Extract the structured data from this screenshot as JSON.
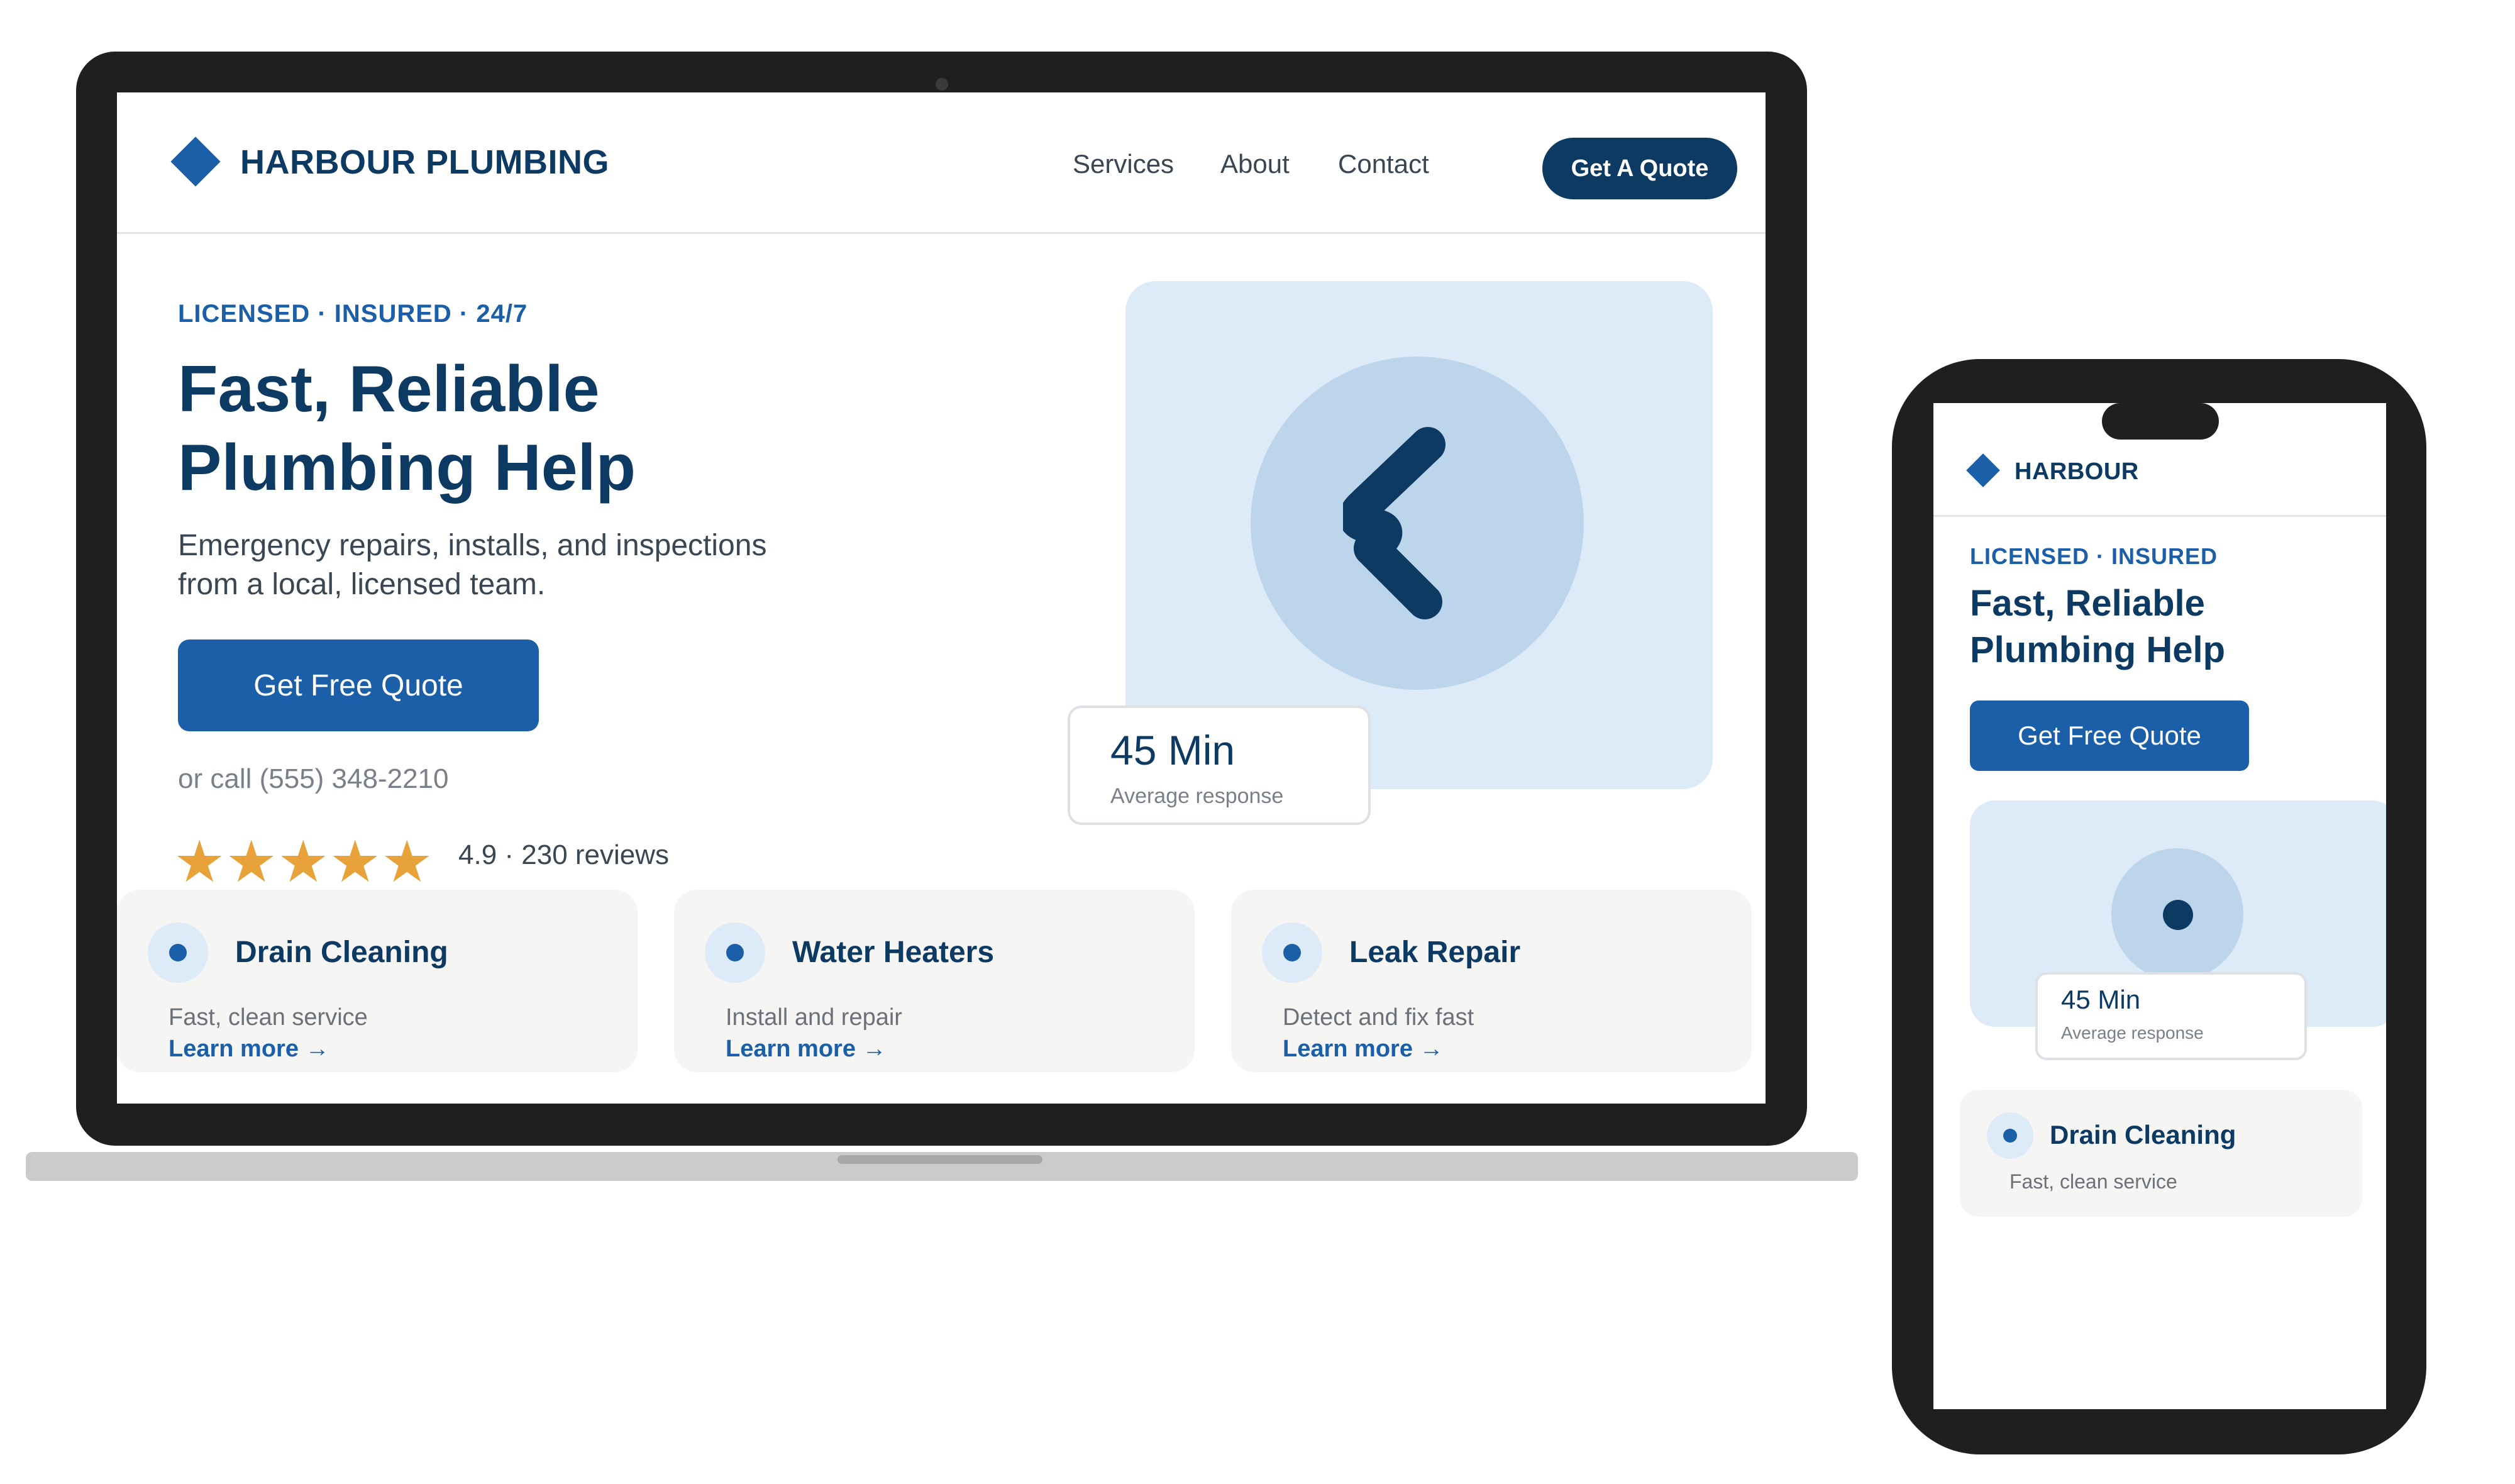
{
  "colors": {
    "brand_navy": "#0d3a63",
    "brand_blue": "#1a5fa8",
    "light_blue": "#ddeaf7",
    "mid_blue": "#bdd5ea",
    "star": "#e8a23a",
    "card_bg": "#f5f5f4",
    "device_frame": "#1f1f1f"
  },
  "laptop": {
    "header": {
      "brand": "HARBOUR PLUMBING",
      "logo_icon": "diamond-icon",
      "nav": [
        "Services",
        "About",
        "Contact"
      ],
      "cta": "Get A Quote"
    },
    "hero": {
      "eyebrow": "LICENSED · INSURED · 24/7",
      "title_line1": "Fast, Reliable",
      "title_line2": "Plumbing Help",
      "subtitle_line1": "Emergency repairs, installs, and inspections",
      "subtitle_line2": "from a local, licensed team.",
      "cta": "Get Free Quote",
      "call_text": "or call (555) 348-2210",
      "rating_stars": 5,
      "rating_text": "4.9 · 230 reviews",
      "illustration_icon": "chevron-left-icon"
    },
    "stat": {
      "value": "45 Min",
      "label": "Average response"
    },
    "services": [
      {
        "title": "Drain Cleaning",
        "desc": "Fast, clean service",
        "link": "Learn more →"
      },
      {
        "title": "Water Heaters",
        "desc": "Install and repair",
        "link": "Learn more →"
      },
      {
        "title": "Leak Repair",
        "desc": "Detect and fix fast",
        "link": "Learn more →"
      }
    ]
  },
  "phone": {
    "brand": "HARBOUR",
    "eyebrow": "LICENSED · INSURED",
    "title_line1": "Fast, Reliable",
    "title_line2": "Plumbing Help",
    "cta": "Get Free Quote",
    "stat": {
      "value": "45 Min",
      "label": "Average response"
    },
    "service": {
      "title": "Drain Cleaning",
      "desc": "Fast, clean service"
    }
  }
}
